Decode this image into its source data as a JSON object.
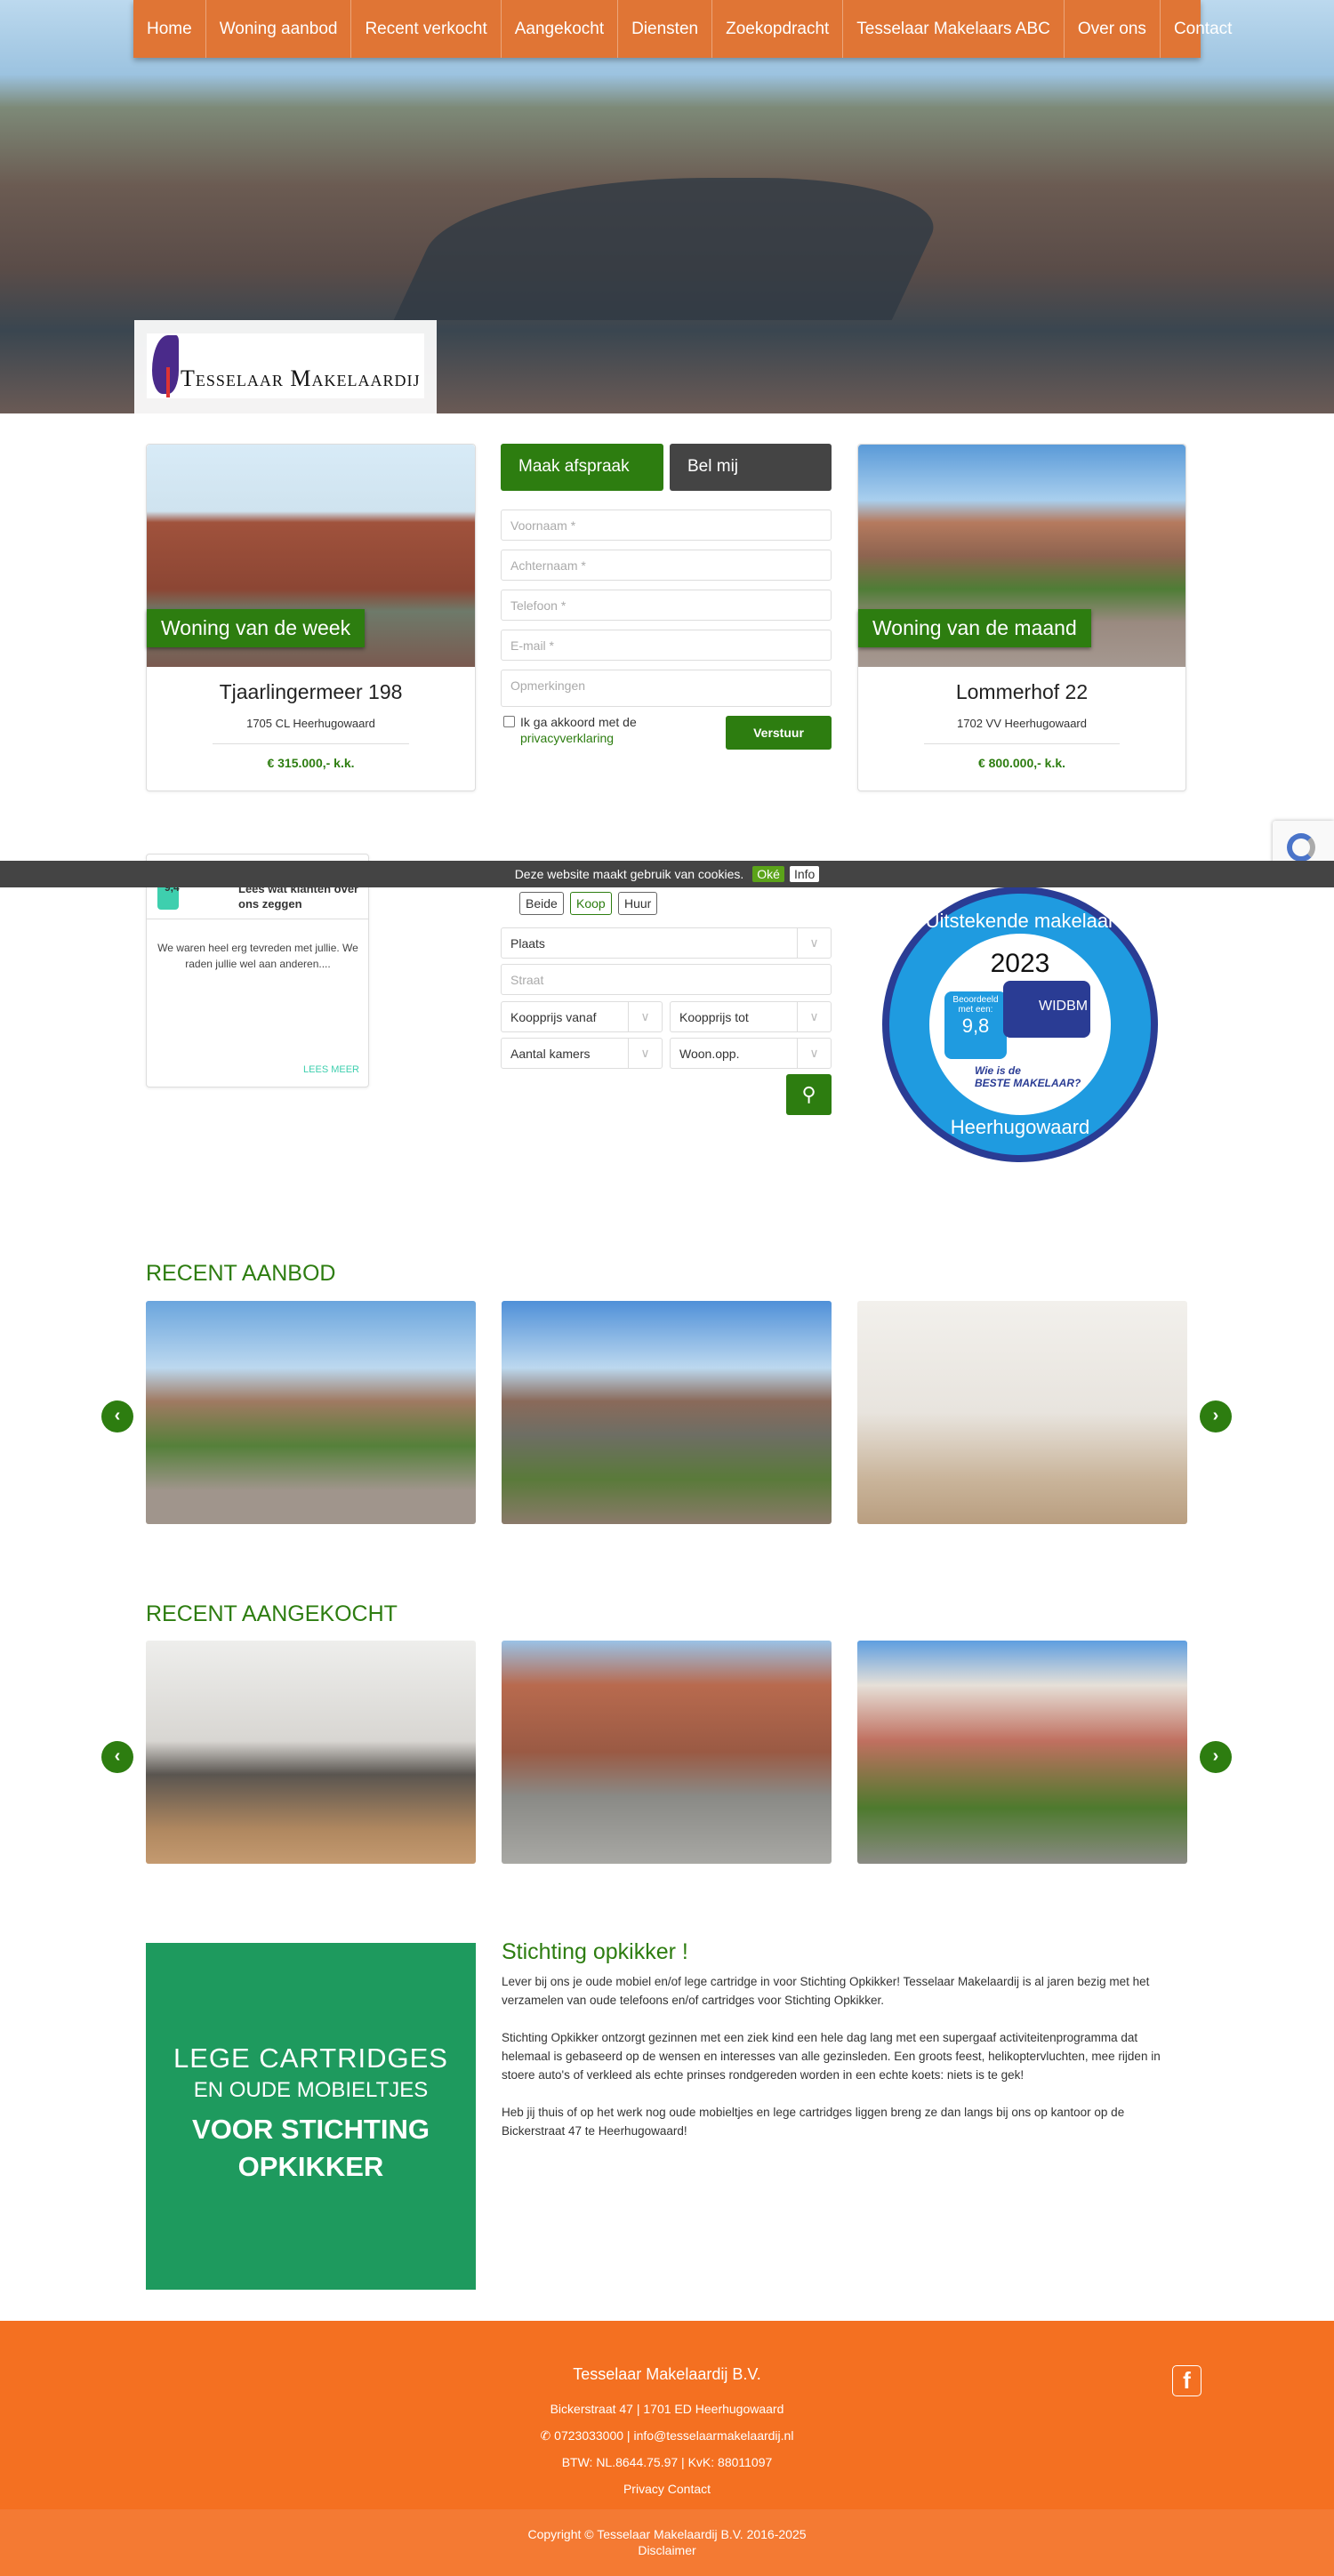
{
  "nav": [
    "Home",
    "Woning aanbod",
    "Recent verkocht",
    "Aangekocht",
    "Diensten",
    "Zoekopdracht",
    "Tesselaar Makelaars ABC",
    "Over ons",
    "Contact"
  ],
  "logo_text": "Tesselaar Makelaardij",
  "week": {
    "badge": "Woning van de week",
    "title": "Tjaarlingermeer 198",
    "address": "1705 CL Heerhugowaard",
    "price": "€ 315.000,- k.k."
  },
  "month": {
    "badge": "Woning van de maand",
    "title": "Lommerhof 22",
    "address": "1702 VV Heerhugowaard",
    "price": "€ 800.000,- k.k."
  },
  "form": {
    "tab_appointment": "Maak afspraak",
    "tab_call": "Bel mij",
    "fields": [
      "Voornaam *",
      "Achternaam *",
      "Telefoon *",
      "E-mail *",
      "Opmerkingen"
    ],
    "agree": "Ik ga akkoord met de",
    "privacy": "privacyverklaring",
    "submit": "Verstuur"
  },
  "cookie": {
    "text": "Deze website maakt gebruik van cookies.",
    "ok": "Oké",
    "info": "Info"
  },
  "review": {
    "score": "9,4",
    "heading": "Lees wat klanten over ons zeggen",
    "text": "We waren heel erg tevreden met jullie. We raden jullie wel aan anderen....",
    "more": "LEES MEER"
  },
  "search": {
    "toggles": [
      "Beide",
      "Koop",
      "Huur"
    ],
    "plaats": "Plaats",
    "straat": "Straat",
    "prijs_vanaf": "Koopprijs vanaf",
    "prijs_tot": "Koopprijs tot",
    "kamers": "Aantal kamers",
    "opp": "Woon.opp."
  },
  "award": {
    "top": "Uitstekende makelaar",
    "year": "2023",
    "rated": "Beoordeeld met een:",
    "score": "9,8",
    "brand": "WIDBM",
    "q1": "Wie is de",
    "q2": "BESTE MAKELAAR?",
    "bottom": "Heerhugowaard"
  },
  "recent_aanbod": "RECENT AANBOD",
  "recent_aangekocht": "RECENT AANGEKOCHT",
  "opkikker": {
    "poster": [
      "LEGE CARTRIDGES",
      "EN OUDE MOBIELTJES",
      "VOOR STICHTING",
      "OPKIKKER"
    ],
    "title": "Stichting opkikker !",
    "p1": "Lever bij ons je oude mobiel en/of lege cartridge in voor Stichting Opkikker! Tesselaar Makelaardij is al jaren bezig met het verzamelen van oude telefoons en/of cartridges voor Stichting Opkikker.",
    "p2": "Stichting Opkikker ontzorgt gezinnen met een ziek kind een hele dag lang met een supergaaf activiteitenprogramma dat helemaal is gebaseerd op de wensen en interesses van alle gezinsleden. Een groots feest, helikoptervluchten, mee rijden in stoere auto's of verkleed als echte prinses rondgereden worden in een echte koets: niets is te gek!",
    "p3": "Heb jij thuis of op het werk nog oude mobieltjes en lege cartridges liggen breng ze dan langs bij ons op kantoor op de Bickerstraat 47 te Heerhugowaard!"
  },
  "footer": {
    "company": "Tesselaar Makelaardij B.V.",
    "street": "Bickerstraat 47",
    "city": "1701 ED Heerhugowaard",
    "phone": "0723033000",
    "email": "info@tesselaarmakelaardij.nl",
    "btw": "BTW: NL.8644.75.97 | KvK: 88011097",
    "privacy": "Privacy",
    "contact": "Contact",
    "copyright": "Copyright © Tesselaar Makelaardij B.V. 2016-2025",
    "disclaimer": "Disclaimer"
  },
  "colors": {
    "green": "#2d7d10",
    "orange": "#f47021",
    "nav": "#e07535"
  }
}
